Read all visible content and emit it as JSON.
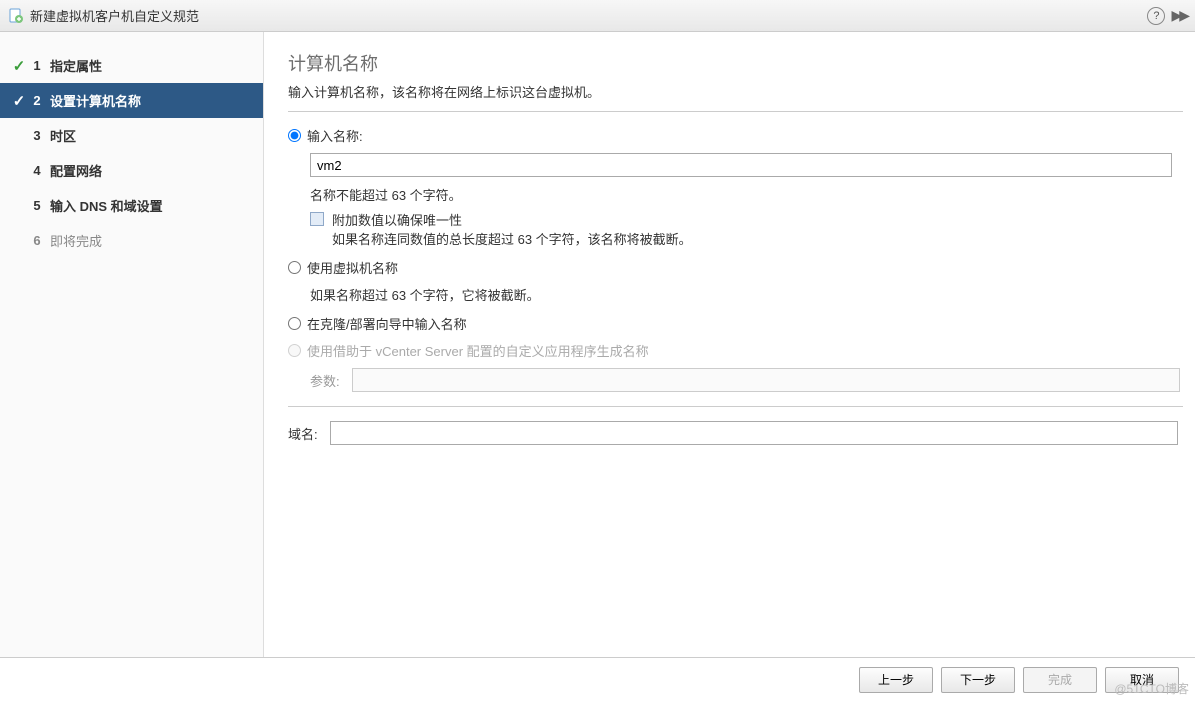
{
  "window": {
    "title": "新建虚拟机客户机自定义规范"
  },
  "sidebar": {
    "steps": [
      {
        "num": "1",
        "label": "指定属性",
        "status": "done"
      },
      {
        "num": "2",
        "label": "设置计算机名称",
        "status": "active"
      },
      {
        "num": "3",
        "label": "时区",
        "status": "pending"
      },
      {
        "num": "4",
        "label": "配置网络",
        "status": "pending"
      },
      {
        "num": "5",
        "label": "输入 DNS 和域设置",
        "status": "pending"
      },
      {
        "num": "6",
        "label": "即将完成",
        "status": "future"
      }
    ]
  },
  "content": {
    "heading": "计算机名称",
    "subtitle": "输入计算机名称，该名称将在网络上标识这台虚拟机。",
    "option_input_name": {
      "label": "输入名称:",
      "value": "vm2",
      "hint": "名称不能超过 63 个字符。",
      "checkbox_label": "附加数值以确保唯一性",
      "checkbox_hint": "如果名称连同数值的总长度超过 63 个字符，该名称将被截断。"
    },
    "option_use_vm_name": {
      "label": "使用虚拟机名称",
      "hint": "如果名称超过 63 个字符，它将被截断。"
    },
    "option_clone_wizard": {
      "label": "在克隆/部署向导中输入名称"
    },
    "option_vcenter_app": {
      "label": "使用借助于 vCenter Server 配置的自定义应用程序生成名称",
      "param_label": "参数:",
      "param_value": ""
    },
    "domain": {
      "label": "域名:",
      "value": ""
    }
  },
  "footer": {
    "back": "上一步",
    "next": "下一步",
    "finish": "完成",
    "cancel": "取消"
  },
  "watermark": "@51CTO博客"
}
